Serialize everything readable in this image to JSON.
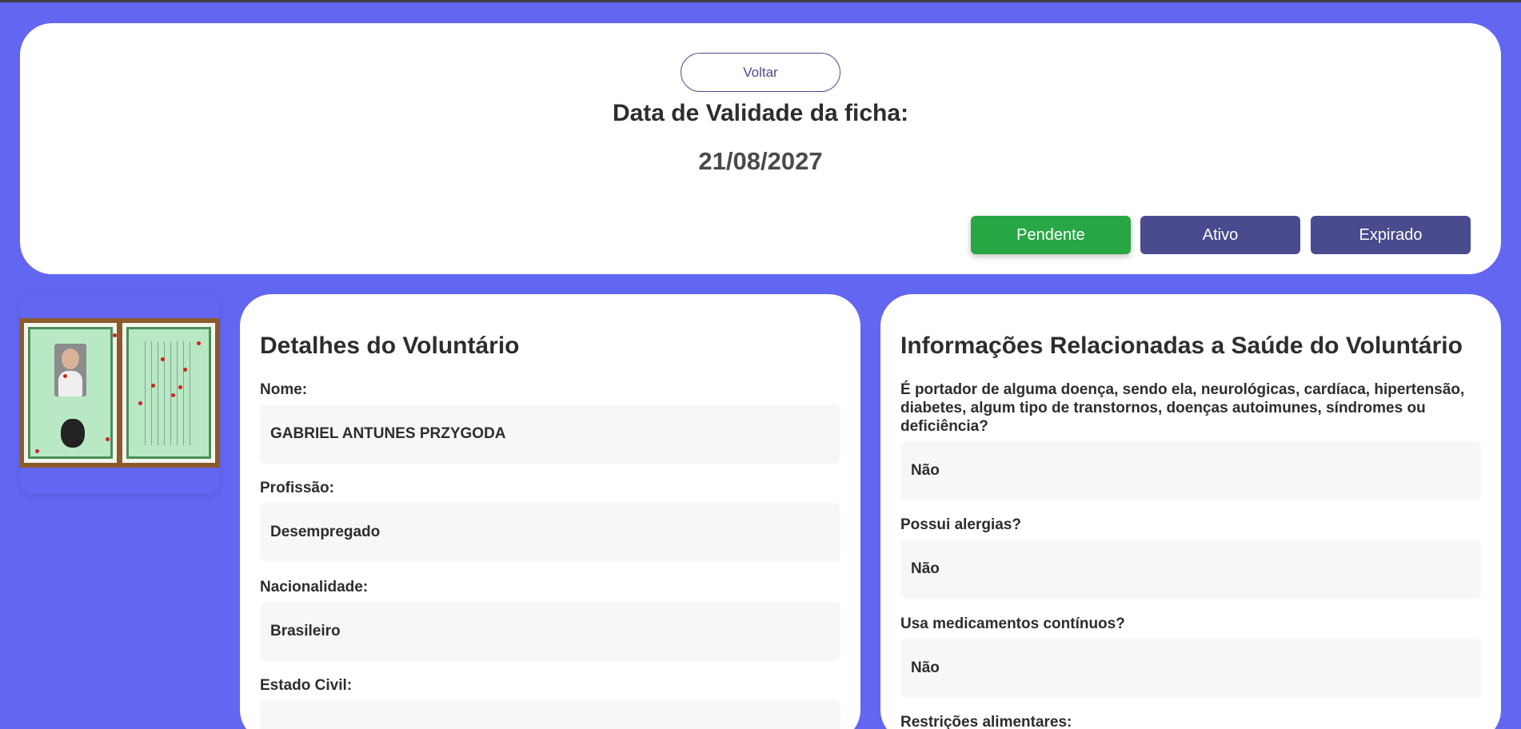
{
  "header": {
    "back_label": "Voltar",
    "validity_title": "Data de Validade da ficha:",
    "validity_date": "21/08/2027",
    "status_buttons": [
      {
        "label": "Pendente",
        "color": "#28a745",
        "active": true
      },
      {
        "label": "Ativo",
        "color": "#4a4a8f",
        "active": false
      },
      {
        "label": "Expirado",
        "color": "#4a4a8f",
        "active": false
      }
    ]
  },
  "document": {
    "icon": "id-document-image"
  },
  "volunteer": {
    "title": "Detalhes do Voluntário",
    "fields": [
      {
        "label": "Nome:",
        "value": "GABRIEL ANTUNES PRZYGODA"
      },
      {
        "label": "Profissão:",
        "value": "Desempregado"
      },
      {
        "label": "Nacionalidade:",
        "value": "Brasileiro"
      },
      {
        "label": "Estado Civil:",
        "value": ""
      }
    ]
  },
  "health": {
    "title": "Informações Relacionadas a Saúde do Voluntário",
    "fields": [
      {
        "label": "É portador de alguma doença, sendo ela, neurológicas, cardíaca, hipertensão, diabetes, algum tipo de transtornos, doenças autoimunes, síndromes ou deficiência?",
        "value": "Não"
      },
      {
        "label": "Possui alergias?",
        "value": "Não"
      },
      {
        "label": "Usa medicamentos contínuos?",
        "value": "Não"
      },
      {
        "label": "Restrições alimentares:",
        "value": ""
      }
    ]
  },
  "colors": {
    "background": "#6366f1",
    "card": "#ffffff",
    "field": "#f7f7f7",
    "primary_button": "#4a4a8f",
    "success_button": "#28a745"
  }
}
